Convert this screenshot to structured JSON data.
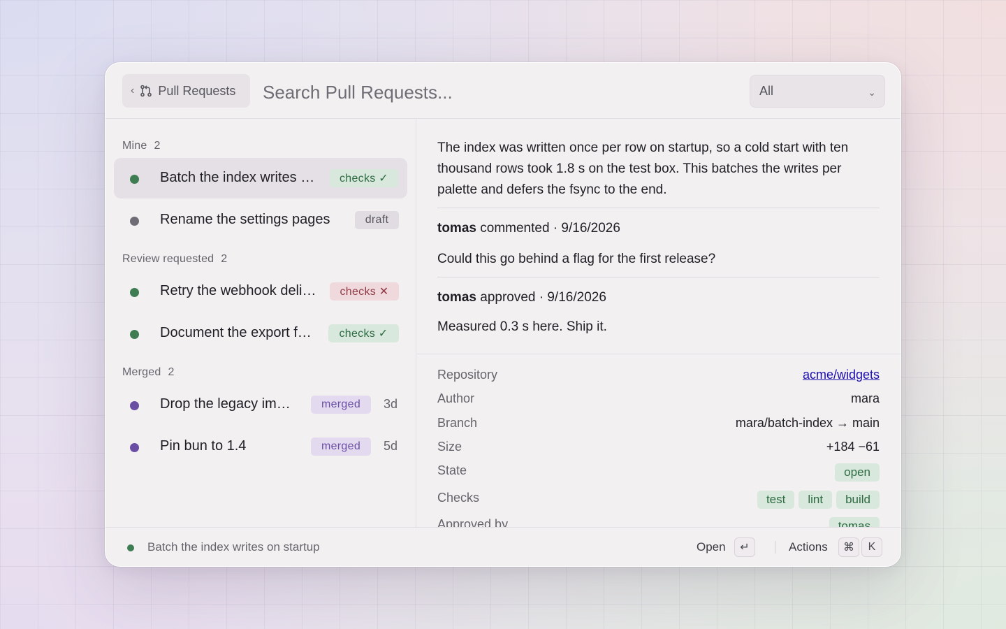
{
  "header": {
    "back_label": "Pull Requests",
    "back_chevron": "‹",
    "search_placeholder": "Search Pull Requests...",
    "filter_value": "All",
    "filter_chevron": "⌄"
  },
  "sections": [
    {
      "title": "Mine",
      "count": "2",
      "items": [
        {
          "title": "Batch the index writes …",
          "status": "green",
          "badge": "checks ✓",
          "badge_kind": "ok",
          "selected": true
        },
        {
          "title": "Rename the settings pages",
          "status": "gray",
          "badge": "draft",
          "badge_kind": "draft"
        }
      ]
    },
    {
      "title": "Review requested",
      "count": "2",
      "items": [
        {
          "title": "Retry the webhook deli…",
          "status": "green",
          "badge": "checks ✕",
          "badge_kind": "fail"
        },
        {
          "title": "Document the export f…",
          "status": "green",
          "badge": "checks ✓",
          "badge_kind": "ok"
        }
      ]
    },
    {
      "title": "Merged",
      "count": "2",
      "items": [
        {
          "title": "Drop the legacy im…",
          "status": "purple",
          "badge": "merged",
          "badge_kind": "merged",
          "age": "3d"
        },
        {
          "title": "Pin bun to 1.4",
          "status": "purple",
          "badge": "merged",
          "badge_kind": "merged",
          "age": "5d"
        }
      ]
    }
  ],
  "detail": {
    "description": "The index was written once per row on startup, so a cold start with ten thousand rows took 1.8 s on the test box. This batches the writes per palette and defers the fsync to the end.",
    "comments": [
      {
        "author": "tomas",
        "action": "commented · 9/16/2026",
        "body": "Could this go behind a flag for the first release?"
      },
      {
        "author": "tomas",
        "action": "approved · 9/16/2026",
        "body": "Measured 0.3 s here. Ship it."
      }
    ]
  },
  "meta": {
    "repository_label": "Repository",
    "repository": "acme/widgets",
    "author_label": "Author",
    "author": "mara",
    "branch_label": "Branch",
    "branch": "mara/batch-index → main",
    "size_label": "Size",
    "size": "+184 −61",
    "state_label": "State",
    "state": "open",
    "checks_label": "Checks",
    "checks": [
      "test",
      "lint",
      "build"
    ],
    "approved_label": "Approved by",
    "approved_by": "tomas"
  },
  "footer": {
    "selected_title": "Batch the index writes on startup",
    "open_label": "Open",
    "open_key": "↵",
    "actions_label": "Actions",
    "actions_keys": [
      "⌘",
      "K"
    ]
  },
  "colors": {
    "green": "#3e7d52",
    "gray": "#6f6c76",
    "purple": "#6a4ea4"
  }
}
